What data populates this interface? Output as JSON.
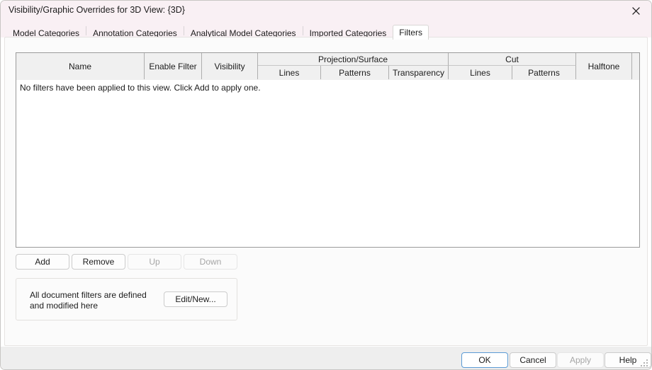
{
  "window": {
    "title": "Visibility/Graphic Overrides for 3D View: {3D}",
    "close_icon": "close-icon",
    "titlebar_color": "#f9f0f4"
  },
  "tabs": [
    {
      "label": "Model Categories",
      "active": false
    },
    {
      "label": "Annotation Categories",
      "active": false
    },
    {
      "label": "Analytical Model Categories",
      "active": false
    },
    {
      "label": "Imported Categories",
      "active": false
    },
    {
      "label": "Filters",
      "active": true
    }
  ],
  "grid": {
    "headers": {
      "name": "Name",
      "enable_filter": "Enable Filter",
      "visibility": "Visibility",
      "projection_surface": "Projection/Surface",
      "projection_lines": "Lines",
      "projection_patterns": "Patterns",
      "projection_transparency": "Transparency",
      "cut": "Cut",
      "cut_lines": "Lines",
      "cut_patterns": "Patterns",
      "halftone": "Halftone"
    },
    "rows": [],
    "empty_message": "No filters have been applied to this view. Click Add to apply one."
  },
  "row_buttons": [
    {
      "label": "Add",
      "enabled": true
    },
    {
      "label": "Remove",
      "enabled": true
    },
    {
      "label": "Up",
      "enabled": false
    },
    {
      "label": "Down",
      "enabled": false
    }
  ],
  "filters_group": {
    "description": "All document filters are defined and modified here",
    "edit_button": "Edit/New..."
  },
  "footer": {
    "ok": "OK",
    "cancel": "Cancel",
    "apply": "Apply",
    "help": "Help",
    "apply_enabled": false,
    "default_button": "OK",
    "focus_color": "#5b9bd5"
  }
}
